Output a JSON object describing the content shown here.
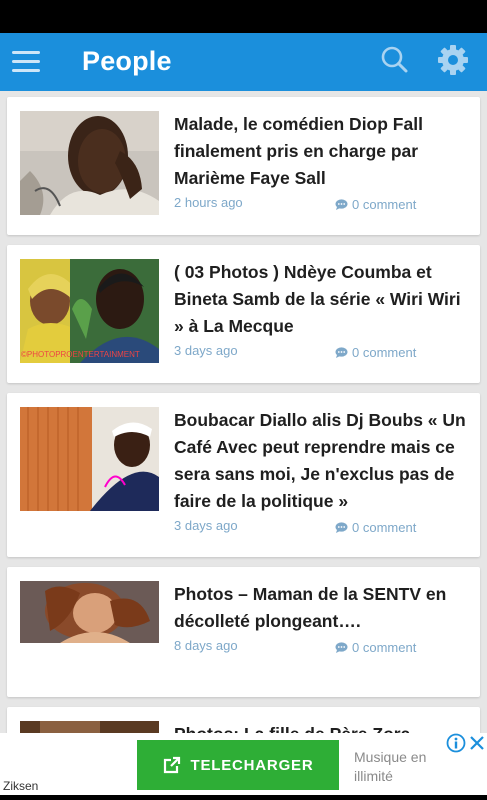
{
  "app_bar": {
    "title": "People",
    "color": "#1b8fdc"
  },
  "icons": {
    "menu": "hamburger-menu-icon",
    "search": "search-icon",
    "settings": "gear-icon",
    "comment": "comment-bubble-icon",
    "download": "external-link-icon",
    "info": "info-icon",
    "close": "close-icon"
  },
  "articles": [
    {
      "title": "Malade, le comédien Diop Fall finalement pris en charge par Marième Faye Sall",
      "time": "2 hours ago",
      "comments": "0 comment"
    },
    {
      "title": "( 03 Photos ) Ndèye Coumba et Bineta Samb de la série « Wiri Wiri » à La Mecque",
      "time": "3 days ago",
      "comments": "0 comment",
      "watermark": "©PHOTOPROENTERTAINMENT"
    },
    {
      "title": "Boubacar Diallo alis Dj Boubs « Un Café Avec peut reprendre mais ce sera sans moi, Je n'exclus pas de faire de la politique »",
      "time": "3 days ago",
      "comments": "0 comment"
    },
    {
      "title": "Photos – Maman de la SENTV en décolleté plongeant….",
      "time": "8 days ago",
      "comments": "0 comment"
    },
    {
      "title": "Photos: La fille de Père Zora",
      "time": "",
      "comments": ""
    }
  ],
  "ad": {
    "cta_label": "TELECHARGER",
    "side_text": "Musique en illimité",
    "brand": "Ziksen",
    "cta_color": "#2eae36"
  }
}
